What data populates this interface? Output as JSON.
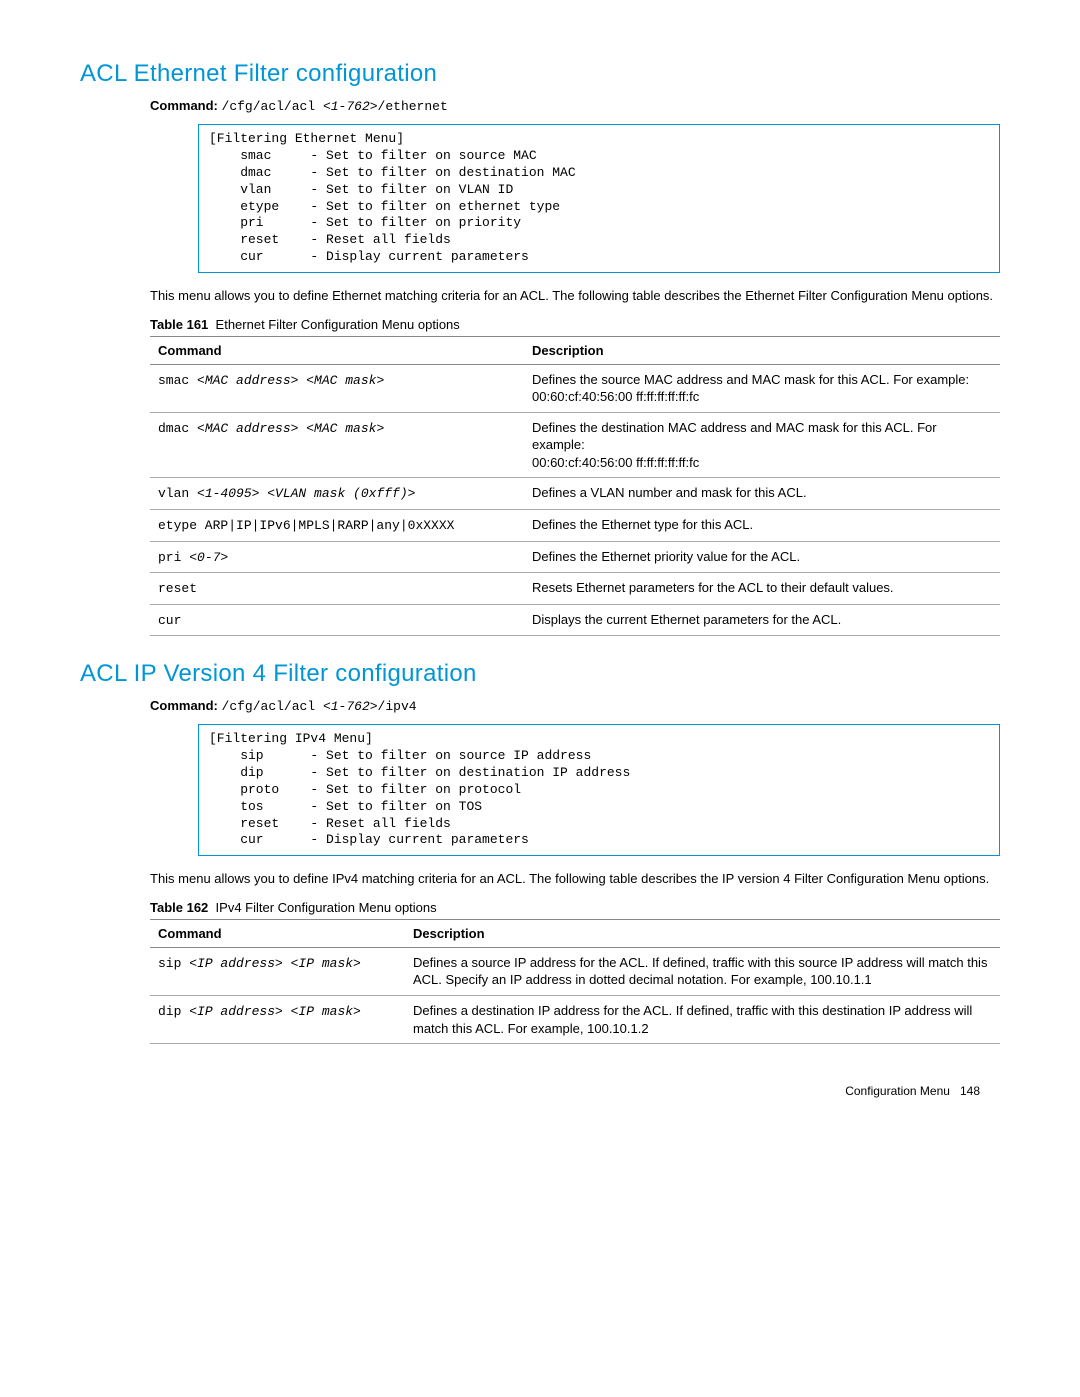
{
  "footer": {
    "left": "Configuration Menu",
    "page": "148"
  },
  "section1": {
    "heading": "ACL Ethernet Filter configuration",
    "cmd_label": "Command:",
    "cmd_pre": "/cfg/acl/acl ",
    "cmd_arg": "<1-762>",
    "cmd_post": "/ethernet",
    "menu": "[Filtering Ethernet Menu]\n    smac     - Set to filter on source MAC\n    dmac     - Set to filter on destination MAC\n    vlan     - Set to filter on VLAN ID\n    etype    - Set to filter on ethernet type\n    pri      - Set to filter on priority\n    reset    - Reset all fields\n    cur      - Display current parameters",
    "para": "This menu allows you to define Ethernet matching criteria for an ACL. The following table describes the Ethernet Filter Configuration Menu options.",
    "table_label": "Table 161",
    "table_title": "Ethernet Filter Configuration Menu options",
    "headers": {
      "c1": "Command",
      "c2": "Description"
    },
    "rows": [
      {
        "cmd_text": "smac ",
        "cmd_arg": "<MAC address> <MAC mask>",
        "desc": "Defines the source MAC address and MAC mask for this ACL. For example:\n00:60:cf:40:56:00 ff:ff:ff:ff:ff:fc"
      },
      {
        "cmd_text": "dmac ",
        "cmd_arg": "<MAC address> <MAC mask>",
        "desc": "Defines the destination MAC address and MAC mask for this ACL. For example:\n00:60:cf:40:56:00 ff:ff:ff:ff:ff:fc"
      },
      {
        "cmd_text": "vlan ",
        "cmd_arg": "<1-4095> <VLAN mask (0xfff)>",
        "desc": "Defines a VLAN number and mask for this ACL."
      },
      {
        "cmd_text": "etype ARP|IP|IPv6|MPLS|RARP|any|0xXXXX",
        "cmd_arg": "",
        "desc": "Defines the Ethernet type for this ACL."
      },
      {
        "cmd_text": "pri ",
        "cmd_arg": "<0-7>",
        "desc": "Defines the Ethernet priority value for the ACL."
      },
      {
        "cmd_text": "reset",
        "cmd_arg": "",
        "desc": "Resets Ethernet parameters for the ACL to their default values."
      },
      {
        "cmd_text": "cur",
        "cmd_arg": "",
        "desc": "Displays the current Ethernet parameters for the ACL."
      }
    ]
  },
  "section2": {
    "heading": "ACL IP Version 4 Filter configuration",
    "cmd_label": "Command:",
    "cmd_pre": "/cfg/acl/acl ",
    "cmd_arg": "<1-762>",
    "cmd_post": "/ipv4",
    "menu": "[Filtering IPv4 Menu]\n    sip      - Set to filter on source IP address\n    dip      - Set to filter on destination IP address\n    proto    - Set to filter on protocol\n    tos      - Set to filter on TOS\n    reset    - Reset all fields\n    cur      - Display current parameters",
    "para": "This menu allows you to define IPv4 matching criteria for an ACL. The following table describes the IP version 4 Filter Configuration Menu options.",
    "table_label": "Table 162",
    "table_title": "IPv4 Filter Configuration Menu options",
    "headers": {
      "c1": "Command",
      "c2": "Description"
    },
    "rows": [
      {
        "cmd_text": "sip ",
        "cmd_arg": "<IP address> <IP mask>",
        "desc": "Defines a source IP address for the ACL. If defined, traffic with this source IP address will match this ACL. Specify an IP address in dotted decimal notation. For example, 100.10.1.1"
      },
      {
        "cmd_text": "dip ",
        "cmd_arg": "<IP address> <IP mask>",
        "desc": "Defines a destination IP address for the ACL. If defined, traffic with this destination IP address will match this ACL. For example, 100.10.1.2"
      }
    ]
  }
}
